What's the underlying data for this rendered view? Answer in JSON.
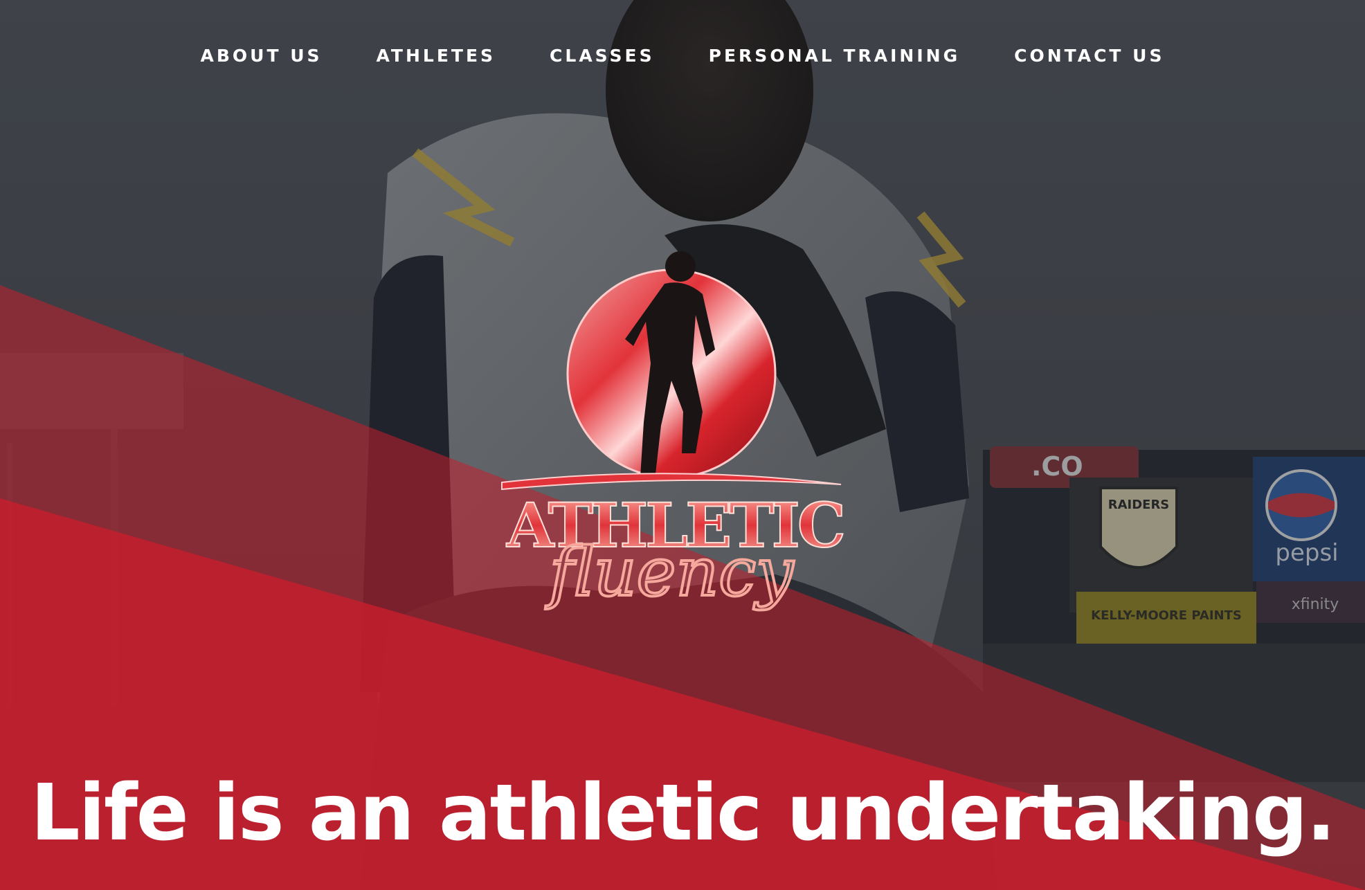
{
  "nav": {
    "items": [
      {
        "label": "ABOUT US"
      },
      {
        "label": "ATHLETES"
      },
      {
        "label": "CLASSES"
      },
      {
        "label": "PERSONAL TRAINING"
      },
      {
        "label": "CONTACT US"
      }
    ]
  },
  "logo": {
    "line1": "ATHLETIC",
    "line2": "fluency",
    "icon": "running-athlete-icon"
  },
  "hero": {
    "tagline": "Life is an athletic undertaking.",
    "background": {
      "scoreboard_texts": [
        ".CO",
        "RAIDERS",
        "pepsi",
        "KELLY-MOORE PAINTS",
        "xfinity"
      ]
    }
  },
  "colors": {
    "accent_red": "#c41f2e",
    "overlay_dark": "#3b3f45",
    "text": "#ffffff"
  }
}
